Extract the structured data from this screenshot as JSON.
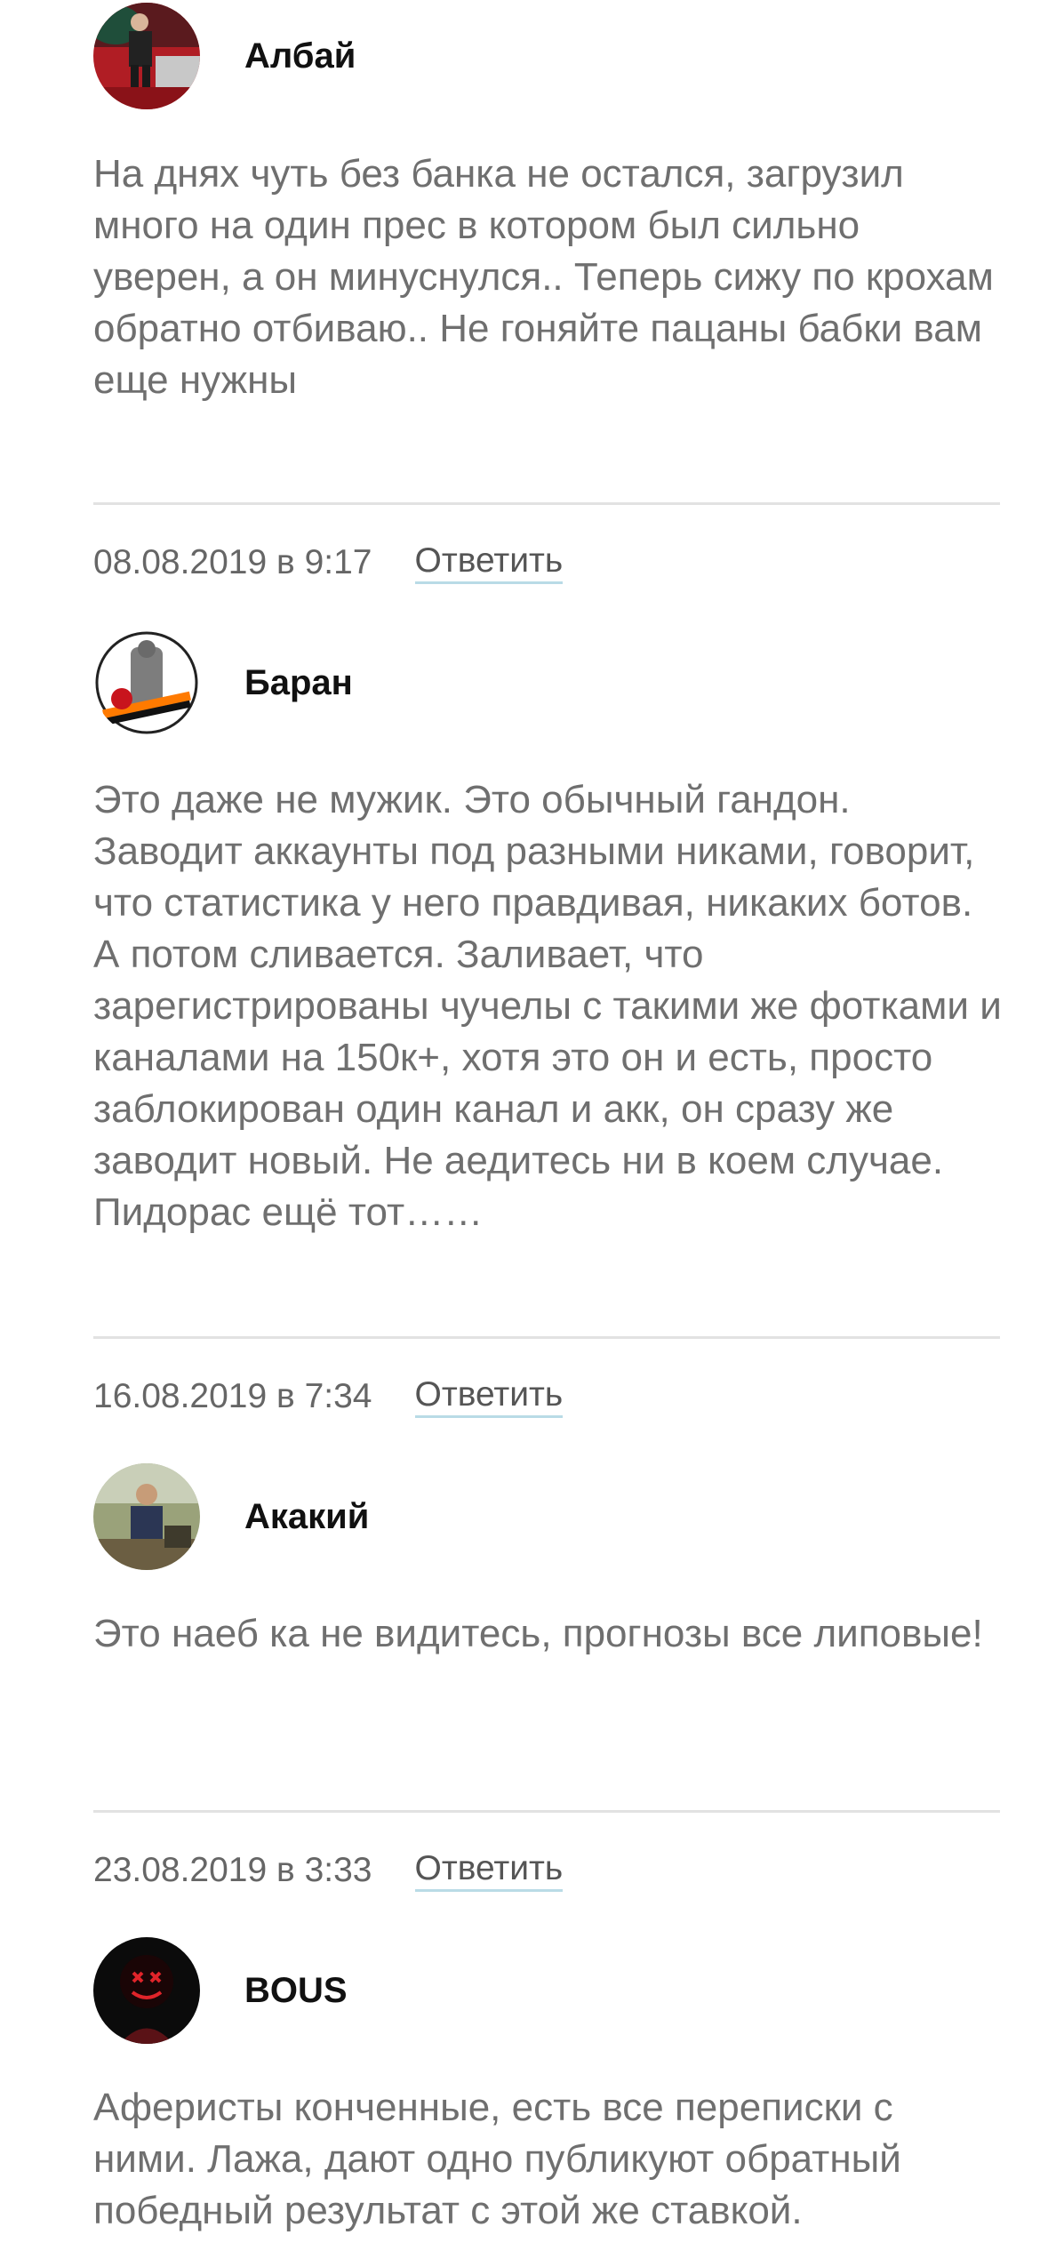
{
  "comments": [
    {
      "author": "Албай",
      "date": "",
      "text": "На днях чуть без банка не остался, загрузил много на один прес в котором был сильно уверен, а он минуснулся.. Теперь сижу по крохам обратно отбиваю.. Не гоняйте пацаны бабки вам еще нужны"
    },
    {
      "author": "Баран",
      "date": "08.08.2019 в 9:17",
      "reply_label": "Ответить",
      "text": "Это даже не мужик. Это обычный гандон. Заводит аккаунты под разными никами, говорит, что статистика у него правдивая, никаких ботов. А потом сливается. Заливает, что зарегистрированы чучелы с такими же фотками и каналами на 150к+, хотя это он и есть, просто заблокирован один канал и акк, он сразу же заводит новый. Не аедитесь ни в коем случае. Пидорас ещё тот……"
    },
    {
      "author": "Акакий",
      "date": "16.08.2019 в 7:34",
      "reply_label": "Ответить",
      "text": "Это наеб ка не видитесь, прогнозы все липовые!"
    },
    {
      "author": "BOUS",
      "date": "23.08.2019 в 3:33",
      "reply_label": "Ответить",
      "text": "Аферисты конченные, есть все переписки с ними. Лажа, дают одно публикуют обратный победный результат с этой же ставкой."
    }
  ],
  "colors": {
    "text": "#6f6f6f",
    "author": "#111111",
    "meta": "#666666",
    "reply_underline": "#b9dbe6",
    "divider": "#e2e2e2"
  }
}
